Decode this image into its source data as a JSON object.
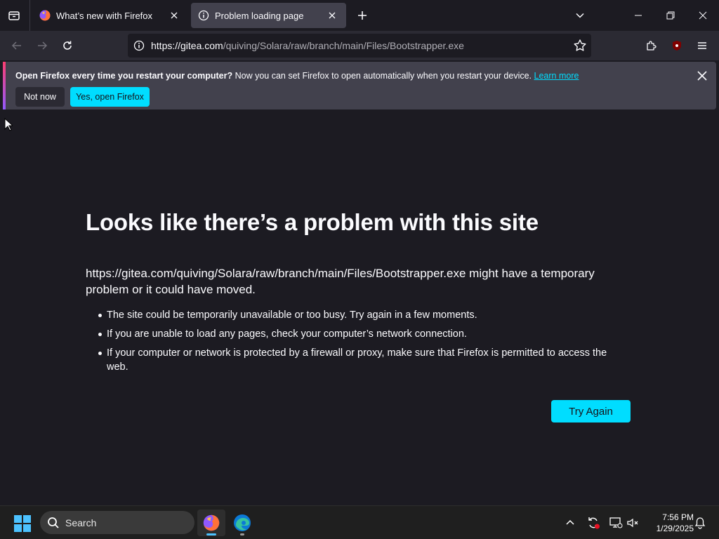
{
  "browser": {
    "tabs": [
      {
        "title": "What’s new with Firefox",
        "active": false
      },
      {
        "title": "Problem loading page",
        "active": true
      }
    ],
    "url": {
      "host": "https://gitea.com",
      "path": "/quiving/Solara/raw/branch/main/Files/Bootstrapper.exe"
    },
    "accent_color": "#00ddff"
  },
  "notification": {
    "bold_text": "Open Firefox every time you restart your computer?",
    "text": " Now you can set Firefox to open automatically when you restart your device. ",
    "link": "Learn more",
    "not_now_label": "Not now",
    "yes_label": "Yes, open Firefox"
  },
  "error_page": {
    "title": "Looks like there’s a problem with this site",
    "description": "https://gitea.com/quiving/Solara/raw/branch/main/Files/Bootstrapper.exe might have a temporary problem or it could have moved.",
    "bullets": [
      "The site could be temporarily unavailable or too busy. Try again in a few moments.",
      "If you are unable to load any pages, check your computer’s network connection.",
      "If your computer or network is protected by a firewall or proxy, make sure that Firefox is permitted to access the web."
    ],
    "try_again_label": "Try Again"
  },
  "taskbar": {
    "search_placeholder": "Search",
    "time": "7:56 PM",
    "date": "1/29/2025"
  }
}
